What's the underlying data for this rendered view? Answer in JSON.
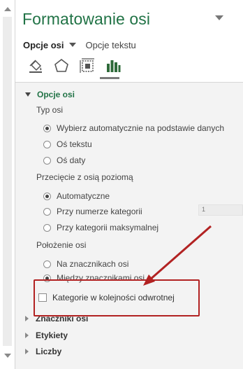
{
  "pane": {
    "title": "Formatowanie osi",
    "tab_active": "Opcje osi",
    "tab_other": "Opcje tekstu",
    "icons": [
      "fill-line-icon",
      "effects-icon",
      "size-properties-icon",
      "axis-options-icon"
    ]
  },
  "section_axis_options": {
    "title": "Opcje osi",
    "axis_type": {
      "label": "Typ osi",
      "options": [
        "Wybierz automatycznie na podstawie danych",
        "Oś tekstu",
        "Oś daty"
      ],
      "selected": 0
    },
    "crossing": {
      "label": "Przecięcie z osią poziomą",
      "options": [
        "Automatyczne",
        "Przy numerze kategorii",
        "Przy kategorii maksymalnej"
      ],
      "selected": 0,
      "category_number_value": "1"
    },
    "position": {
      "label": "Położenie osi",
      "options": [
        "Na znacznikach osi",
        "Między znacznikami osi"
      ],
      "selected": 1
    },
    "reverse_order_label": "Kategorie w kolejności odwrotnej",
    "reverse_order_checked": false
  },
  "collapsed_sections": [
    "Znaczniki osi",
    "Etykiety",
    "Liczby"
  ],
  "colors": {
    "accent_green": "#217346",
    "annotation_red": "#b22222",
    "content_background": "#f3f3f3"
  }
}
